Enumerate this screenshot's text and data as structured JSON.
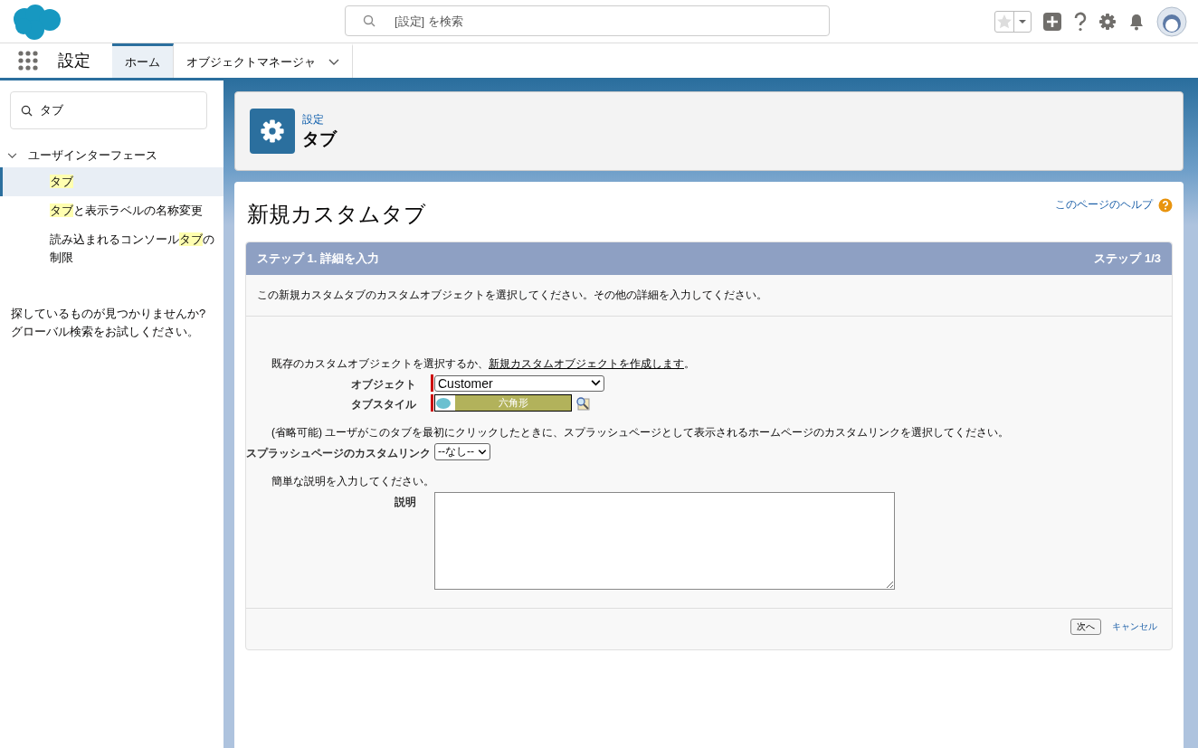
{
  "header": {
    "search_placeholder": "[設定] を検索"
  },
  "nav": {
    "app_name": "設定",
    "tabs": [
      {
        "label": "ホーム",
        "selected": true,
        "menu": false
      },
      {
        "label": "オブジェクトマネージャ",
        "selected": false,
        "menu": true
      }
    ]
  },
  "sidebar": {
    "search_value": "タブ",
    "tree": [
      {
        "label": "ユーザインターフェース",
        "expanded": true,
        "children": [
          {
            "parts": [
              {
                "text": "タブ",
                "highlighted": true
              }
            ],
            "selected": true
          },
          {
            "parts": [
              {
                "text": "タブ",
                "highlighted": true
              },
              {
                "text": "と表示ラベルの名称変更",
                "highlighted": false
              }
            ],
            "selected": false
          },
          {
            "parts": [
              {
                "text": "読み込まれるコンソール",
                "highlighted": false
              },
              {
                "text": "タブ",
                "highlighted": true
              },
              {
                "text": "の制限",
                "highlighted": false
              }
            ],
            "selected": false
          }
        ]
      }
    ],
    "not_found": "探しているものが見つかりませんか?\nグローバル検索をお試しください。"
  },
  "page_header": {
    "breadcrumb": "設定",
    "title": "タブ"
  },
  "content": {
    "title": "新規カスタムタブ",
    "help_link": "このページのヘルプ",
    "step_title": "ステップ 1. 詳細を入力",
    "step_count": "ステップ 1/3",
    "intro": "この新規カスタムタブのカスタムオブジェクトを選択してください。その他の詳細を入力してください。",
    "sections": [
      {
        "instruction": [
          {
            "text": "既存のカスタムオブジェクトを選択するか、",
            "link": false
          },
          {
            "text": "新規カスタムオブジェクトを作成します",
            "link": true
          },
          {
            "text": "。",
            "link": false
          }
        ],
        "fields": [
          {
            "kind": "select",
            "label": "オブジェクト",
            "required": true,
            "value": "Customer"
          },
          {
            "kind": "style",
            "label": "タブスタイル",
            "required": true,
            "value": "六角形"
          }
        ]
      },
      {
        "instruction": [
          {
            "text": "(省略可能) ユーザがこのタブを最初にクリックしたときに、スプラッシュページとして表示されるホームページのカスタムリンクを選択してください。",
            "link": false
          }
        ],
        "fields": [
          {
            "kind": "small-select",
            "label": "スプラッシュページのカスタムリンク",
            "required": false,
            "value": "--なし--"
          }
        ]
      },
      {
        "instruction": [
          {
            "text": "簡単な説明を入力してください。",
            "link": false
          }
        ],
        "fields": [
          {
            "kind": "textarea",
            "label": "説明",
            "required": false
          }
        ]
      }
    ],
    "buttons": [
      {
        "kind": "button",
        "label": "次へ"
      },
      {
        "kind": "link",
        "label": "キャンセル"
      }
    ]
  }
}
